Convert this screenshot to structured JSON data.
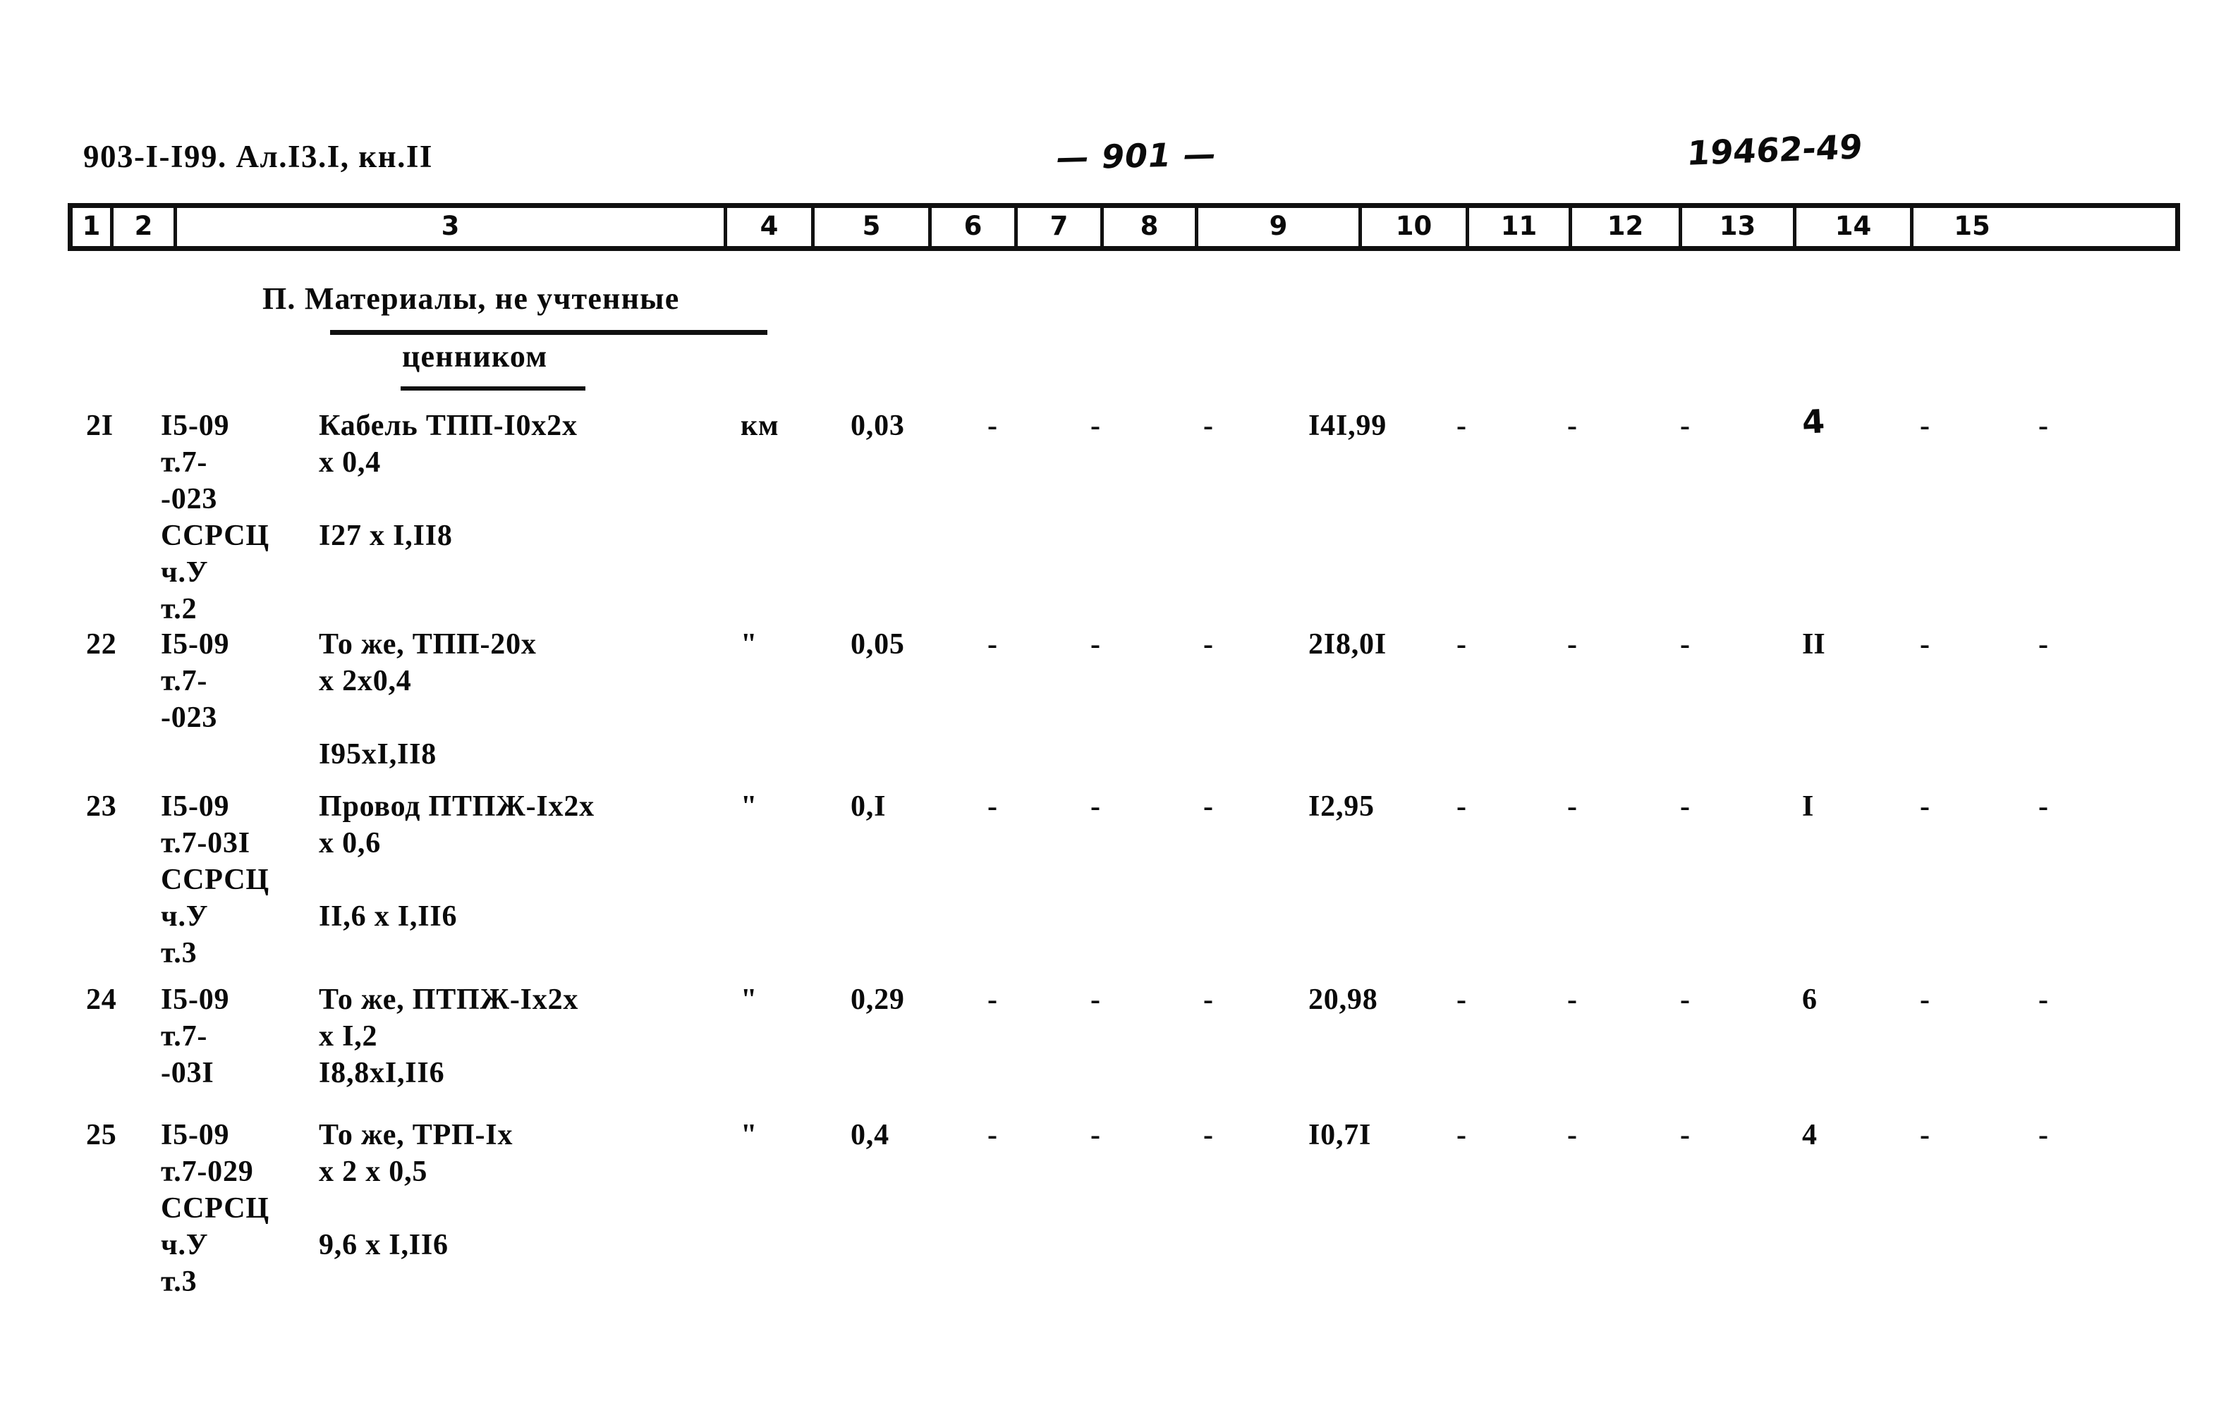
{
  "header": {
    "doc_code": "903-I-I99. Ал.I3.I, кн.II",
    "page_number": "— 901 —",
    "archive_stamp": "19462-49"
  },
  "column_numbers": [
    "1",
    "2",
    "3",
    "4",
    "5",
    "6",
    "7",
    "8",
    "9",
    "10",
    "11",
    "12",
    "13",
    "14",
    "15"
  ],
  "section": {
    "title_line1": "П. Материалы, не учтенные",
    "title_line2": "ценником"
  },
  "rows": [
    {
      "no": "2I",
      "code_lines": [
        "I5-09",
        "т.7-",
        "-023",
        "ССРСЦ",
        "ч.У",
        "т.2"
      ],
      "name_lines": [
        "Кабель ТПП-I0x2x",
        "x 0,4",
        "",
        "I27 x I,II8"
      ],
      "unit": "км",
      "c5": "0,03",
      "c6": "-",
      "c7": "-",
      "c8": "-",
      "c9": "I4I,99",
      "c10": "-",
      "c11": "-",
      "c12": "-",
      "c13": "4",
      "c13_hand": true,
      "c14": "-",
      "c15": "-"
    },
    {
      "no": "22",
      "code_lines": [
        "I5-09",
        "т.7-",
        "-023"
      ],
      "name_lines": [
        "То же, ТПП-20x",
        "x 2x0,4",
        "",
        "I95xI,II8"
      ],
      "unit": "\"",
      "c5": "0,05",
      "c6": "-",
      "c7": "-",
      "c8": "-",
      "c9": "2I8,0I",
      "c10": "-",
      "c11": "-",
      "c12": "-",
      "c13": "II",
      "c13_hand": false,
      "c14": "-",
      "c15": "-"
    },
    {
      "no": "23",
      "code_lines": [
        "I5-09",
        "т.7-03I",
        "ССРСЦ",
        "ч.У",
        "т.3"
      ],
      "name_lines": [
        "Провод ПТПЖ-Ix2x",
        "x 0,6",
        "",
        "II,6 x I,II6"
      ],
      "unit": "\"",
      "c5": "0,I",
      "c6": "-",
      "c7": "-",
      "c8": "-",
      "c9": "I2,95",
      "c10": "-",
      "c11": "-",
      "c12": "-",
      "c13": "I",
      "c13_hand": false,
      "c14": "-",
      "c15": "-"
    },
    {
      "no": "24",
      "code_lines": [
        "I5-09",
        "т.7-",
        "-03I"
      ],
      "name_lines": [
        "То же, ПТПЖ-Ix2x",
        "x I,2",
        "I8,8xI,II6"
      ],
      "unit": "\"",
      "c5": "0,29",
      "c6": "-",
      "c7": "-",
      "c8": "-",
      "c9": "20,98",
      "c10": "-",
      "c11": "-",
      "c12": "-",
      "c13": "6",
      "c13_hand": false,
      "c14": "-",
      "c15": "-"
    },
    {
      "no": "25",
      "code_lines": [
        "I5-09",
        "т.7-029",
        "ССРСЦ",
        "ч.У",
        "т.3"
      ],
      "name_lines": [
        "То же, ТРП-Ix",
        "x 2 x 0,5",
        "",
        "9,6 x I,II6"
      ],
      "unit": "\"",
      "c5": "0,4",
      "c6": "-",
      "c7": "-",
      "c8": "-",
      "c9": "I0,7I",
      "c10": "-",
      "c11": "-",
      "c12": "-",
      "c13": "4",
      "c13_hand": false,
      "c14": "-",
      "c15": "-"
    }
  ]
}
